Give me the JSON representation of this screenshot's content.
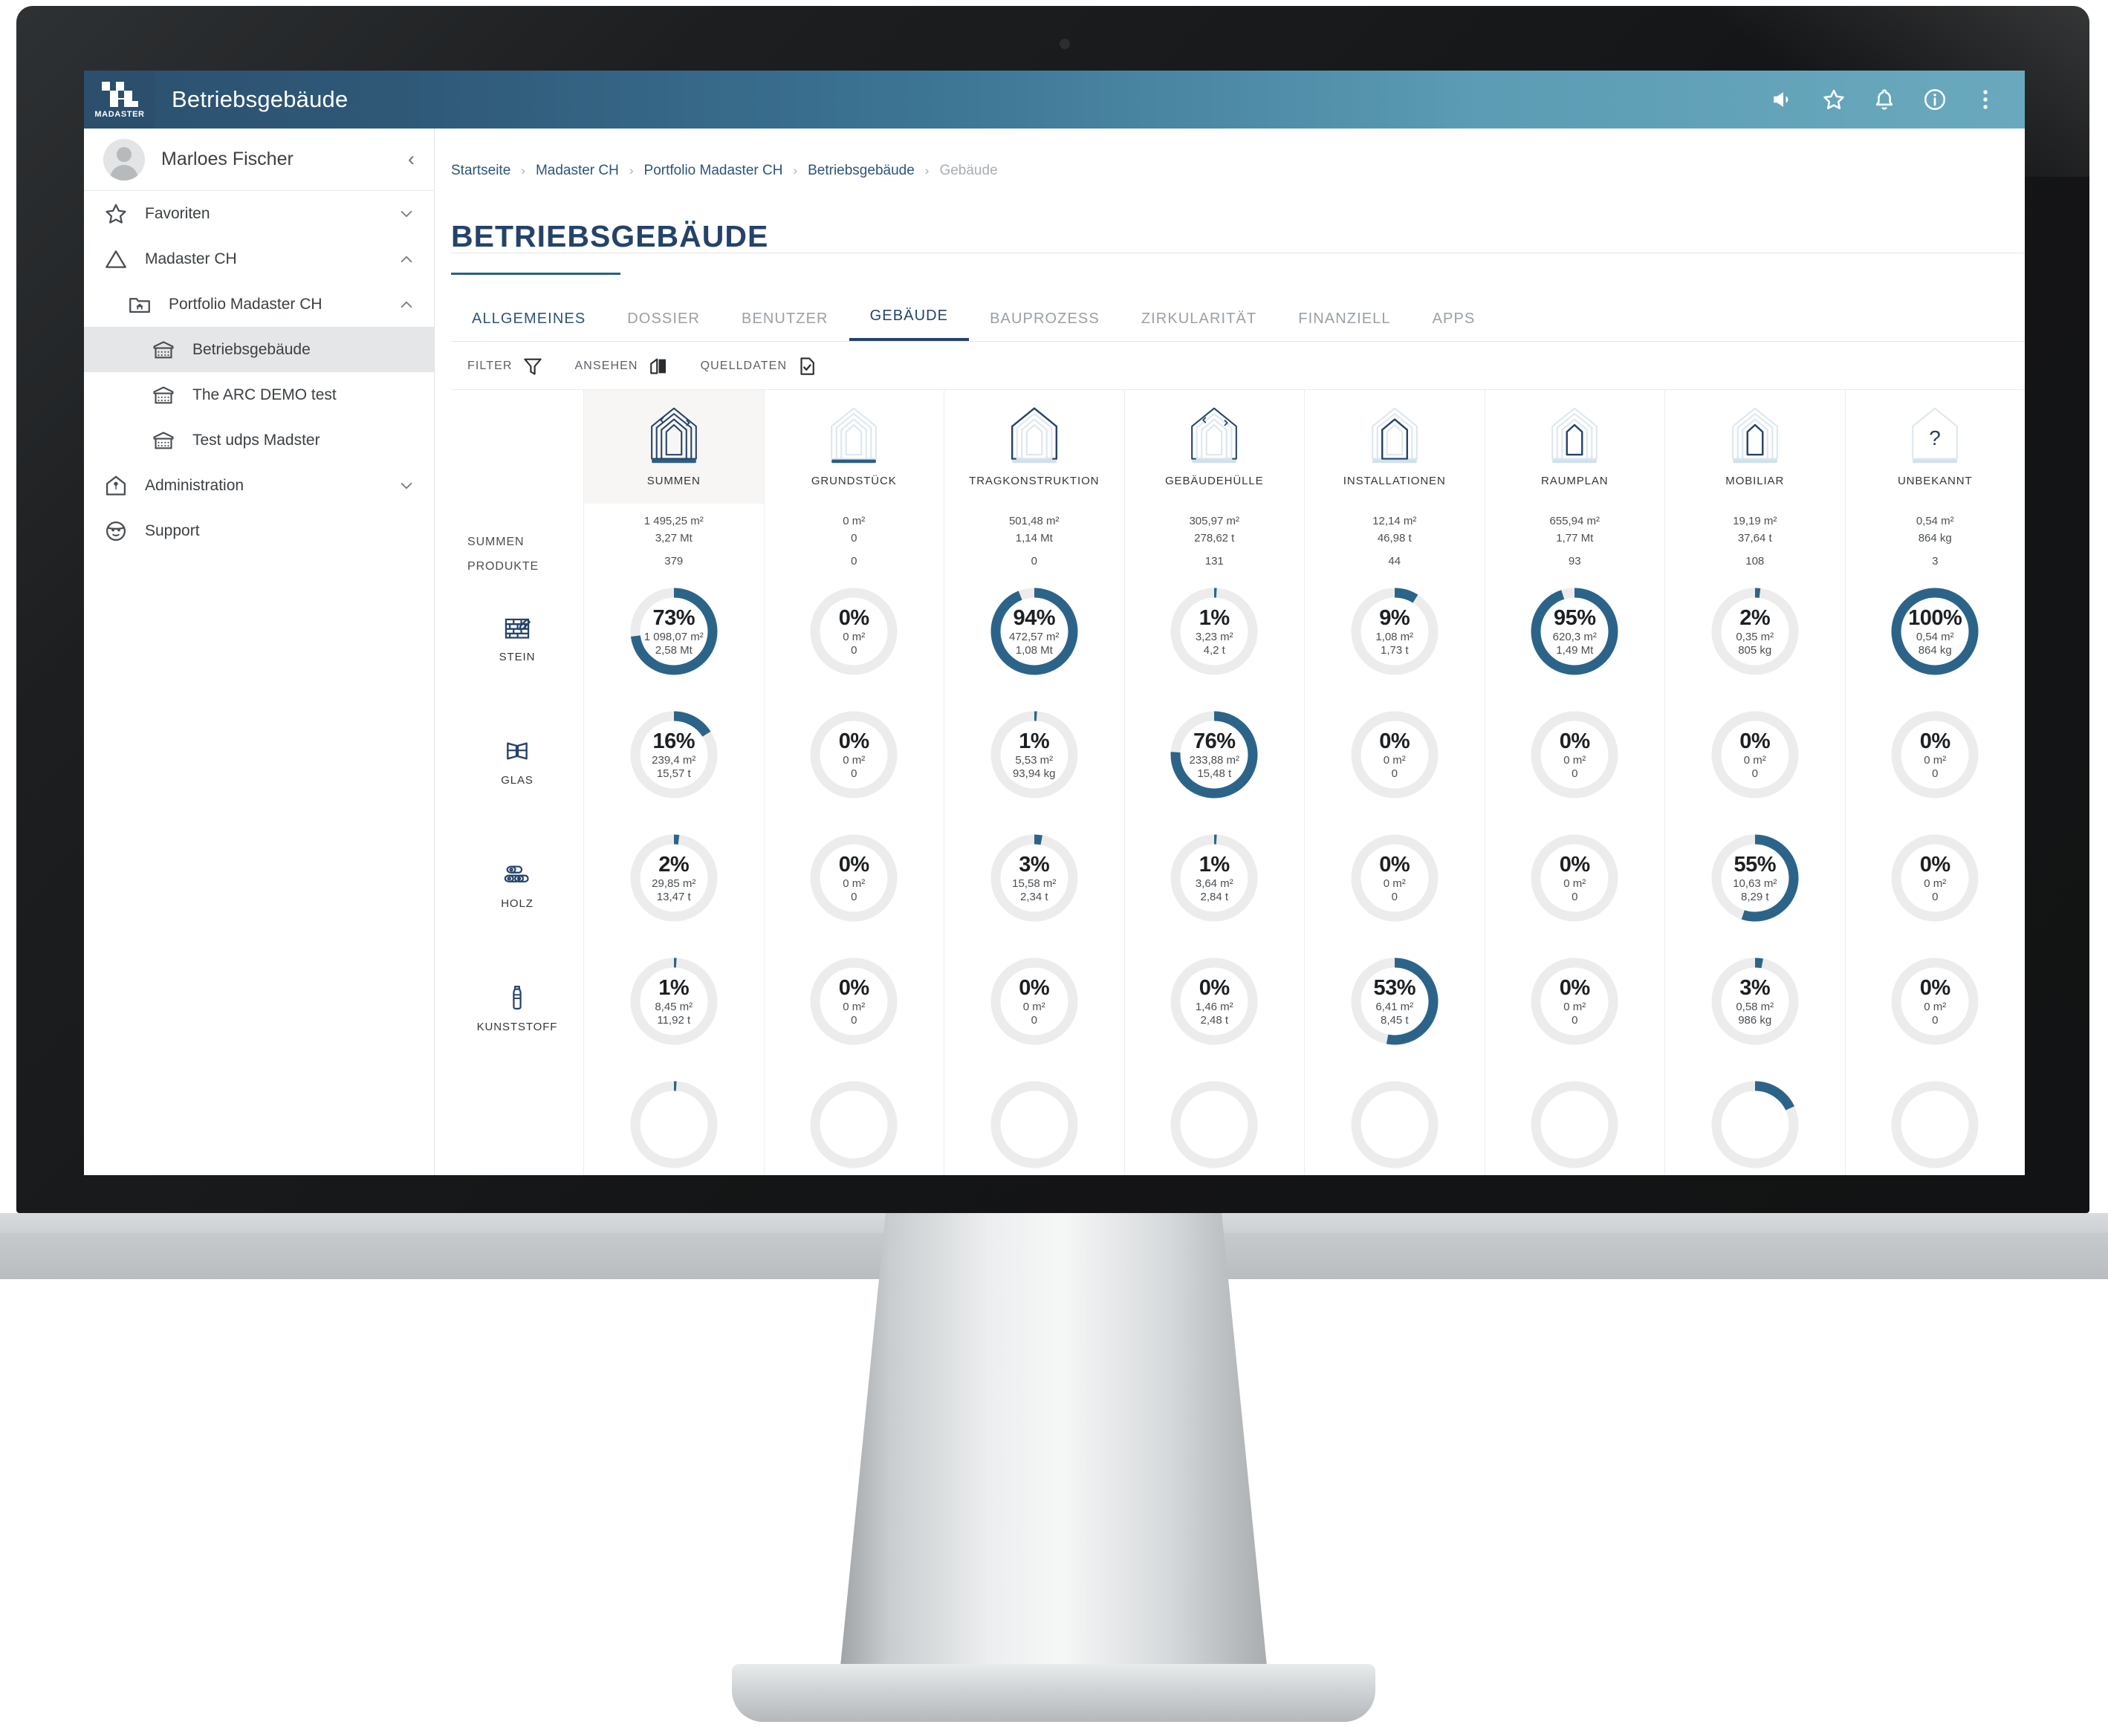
{
  "topbar": {
    "logo_word": "MADASTER",
    "app_title": "Betriebsgebäude",
    "actions": [
      {
        "name": "announcement-icon",
        "label": "Ankündigungen"
      },
      {
        "name": "favorite-star-icon",
        "label": "Favoriten"
      },
      {
        "name": "bell-icon",
        "label": "Benachrichtigungen"
      },
      {
        "name": "info-icon",
        "label": "Information"
      },
      {
        "name": "more-vertical-icon",
        "label": "Mehr"
      }
    ]
  },
  "sidebar": {
    "user_name": "Marloes Fischer",
    "collapse_glyph": "‹",
    "items": [
      {
        "label": "Favoriten",
        "icon": "star-icon",
        "level": 0,
        "chevron": "down",
        "active": false
      },
      {
        "label": "Madaster CH",
        "icon": "triangle-icon",
        "level": 0,
        "chevron": "up",
        "active": false
      },
      {
        "label": "Portfolio Madaster CH",
        "icon": "folder-home-icon",
        "level": 1,
        "chevron": "up",
        "active": false
      },
      {
        "label": "Betriebsgebäude",
        "icon": "building-icon",
        "level": 2,
        "chevron": "none",
        "active": true
      },
      {
        "label": "The ARC DEMO test",
        "icon": "building-icon",
        "level": 2,
        "chevron": "none",
        "active": false
      },
      {
        "label": "Test udps Madster",
        "icon": "building-icon",
        "level": 2,
        "chevron": "none",
        "active": false
      },
      {
        "label": "Administration",
        "icon": "home-shield-icon",
        "level": 0,
        "chevron": "down",
        "active": false
      },
      {
        "label": "Support",
        "icon": "support-face-icon",
        "level": 0,
        "chevron": "none",
        "active": false
      }
    ]
  },
  "main": {
    "breadcrumb": [
      {
        "label": "Startseite",
        "current": false
      },
      {
        "label": "Madaster CH",
        "current": false
      },
      {
        "label": "Portfolio Madaster CH",
        "current": false
      },
      {
        "label": "Betriebsgebäude",
        "current": false
      },
      {
        "label": "Gebäude",
        "current": true
      }
    ],
    "breadcrumb_separator": "›",
    "page_title": "BETRIEBSGEBÄUDE",
    "tabs": [
      {
        "label": "ALLGEMEINES",
        "selected": false,
        "style": "alt"
      },
      {
        "label": "DOSSIER",
        "selected": false,
        "style": "muted"
      },
      {
        "label": "BENUTZER",
        "selected": false,
        "style": "muted"
      },
      {
        "label": "GEBÄUDE",
        "selected": true,
        "style": "selected"
      },
      {
        "label": "BAUPROZESS",
        "selected": false,
        "style": "muted"
      },
      {
        "label": "ZIRKULARITÄT",
        "selected": false,
        "style": "muted"
      },
      {
        "label": "FINANZIELL",
        "selected": false,
        "style": "muted"
      },
      {
        "label": "APPS",
        "selected": false,
        "style": "muted"
      }
    ],
    "toolbar": [
      {
        "label": "FILTER",
        "icon": "funnel-icon"
      },
      {
        "label": "ANSEHEN",
        "icon": "view-panels-icon"
      },
      {
        "label": "QUELLDATEN",
        "icon": "document-check-icon"
      }
    ]
  },
  "matrix": {
    "row_header_labels": {
      "sum": "SUMMEN",
      "products": "PRODUKTE"
    },
    "columns": [
      {
        "name": "SUMMEN",
        "icon": "house-layers-all-icon",
        "highlight": true,
        "area": "1 495,25 m²",
        "mass": "3,27 Mt",
        "products": "379"
      },
      {
        "name": "GRUNDSTÜCK",
        "icon": "house-ground-icon",
        "highlight": false,
        "area": "0 m²",
        "mass": "0",
        "products": "0"
      },
      {
        "name": "TRAGKONSTRUKTION",
        "icon": "house-structure-icon",
        "highlight": false,
        "area": "501,48 m²",
        "mass": "1,14 Mt",
        "products": "0"
      },
      {
        "name": "GEBÄUDEHÜLLE",
        "icon": "house-skin-icon",
        "highlight": false,
        "area": "305,97 m²",
        "mass": "278,62 t",
        "products": "131"
      },
      {
        "name": "INSTALLATIONEN",
        "icon": "house-installations-icon",
        "highlight": false,
        "area": "12,14 m²",
        "mass": "46,98 t",
        "products": "44"
      },
      {
        "name": "RAUMPLAN",
        "icon": "house-spaceplan-icon",
        "highlight": false,
        "area": "655,94 m²",
        "mass": "1,77 Mt",
        "products": "93"
      },
      {
        "name": "MOBILIAR",
        "icon": "house-furniture-icon",
        "highlight": false,
        "area": "19,19 m²",
        "mass": "37,64 t",
        "products": "108"
      },
      {
        "name": "UNBEKANNT",
        "icon": "house-unknown-icon",
        "highlight": false,
        "area": "0,54 m²",
        "mass": "864 kg",
        "products": "3"
      }
    ],
    "rows": [
      {
        "name": "STEIN",
        "icon": "brick-wall-icon",
        "cells": [
          {
            "pct": 73,
            "pct_label": "73%",
            "area": "1 098,07 m²",
            "mass": "2,58 Mt"
          },
          {
            "pct": 0,
            "pct_label": "0%",
            "area": "0 m²",
            "mass": "0"
          },
          {
            "pct": 94,
            "pct_label": "94%",
            "area": "472,57 m²",
            "mass": "1,08 Mt"
          },
          {
            "pct": 1,
            "pct_label": "1%",
            "area": "3,23 m²",
            "mass": "4,2 t"
          },
          {
            "pct": 9,
            "pct_label": "9%",
            "area": "1,08 m²",
            "mass": "1,73 t"
          },
          {
            "pct": 95,
            "pct_label": "95%",
            "area": "620,3 m²",
            "mass": "1,49 Mt"
          },
          {
            "pct": 2,
            "pct_label": "2%",
            "area": "0,35 m²",
            "mass": "805 kg"
          },
          {
            "pct": 100,
            "pct_label": "100%",
            "area": "0,54 m²",
            "mass": "864 kg"
          }
        ]
      },
      {
        "name": "GLAS",
        "icon": "window-glass-icon",
        "cells": [
          {
            "pct": 16,
            "pct_label": "16%",
            "area": "239,4 m²",
            "mass": "15,57 t"
          },
          {
            "pct": 0,
            "pct_label": "0%",
            "area": "0 m²",
            "mass": "0"
          },
          {
            "pct": 1,
            "pct_label": "1%",
            "area": "5,53 m²",
            "mass": "93,94 kg"
          },
          {
            "pct": 76,
            "pct_label": "76%",
            "area": "233,88 m²",
            "mass": "15,48 t"
          },
          {
            "pct": 0,
            "pct_label": "0%",
            "area": "0 m²",
            "mass": "0"
          },
          {
            "pct": 0,
            "pct_label": "0%",
            "area": "0 m²",
            "mass": "0"
          },
          {
            "pct": 0,
            "pct_label": "0%",
            "area": "0 m²",
            "mass": "0"
          },
          {
            "pct": 0,
            "pct_label": "0%",
            "area": "0 m²",
            "mass": "0"
          }
        ]
      },
      {
        "name": "HOLZ",
        "icon": "timber-logs-icon",
        "cells": [
          {
            "pct": 2,
            "pct_label": "2%",
            "area": "29,85 m²",
            "mass": "13,47 t"
          },
          {
            "pct": 0,
            "pct_label": "0%",
            "area": "0 m²",
            "mass": "0"
          },
          {
            "pct": 3,
            "pct_label": "3%",
            "area": "15,58 m²",
            "mass": "2,34 t"
          },
          {
            "pct": 1,
            "pct_label": "1%",
            "area": "3,64 m²",
            "mass": "2,84 t"
          },
          {
            "pct": 0,
            "pct_label": "0%",
            "area": "0 m²",
            "mass": "0"
          },
          {
            "pct": 0,
            "pct_label": "0%",
            "area": "0 m²",
            "mass": "0"
          },
          {
            "pct": 55,
            "pct_label": "55%",
            "area": "10,63 m²",
            "mass": "8,29 t"
          },
          {
            "pct": 0,
            "pct_label": "0%",
            "area": "0 m²",
            "mass": "0"
          }
        ]
      },
      {
        "name": "KUNSTSTOFF",
        "icon": "plastic-bottle-icon",
        "cells": [
          {
            "pct": 1,
            "pct_label": "1%",
            "area": "8,45 m²",
            "mass": "11,92 t"
          },
          {
            "pct": 0,
            "pct_label": "0%",
            "area": "0 m²",
            "mass": "0"
          },
          {
            "pct": 0,
            "pct_label": "0%",
            "area": "0 m²",
            "mass": "0"
          },
          {
            "pct": 0,
            "pct_label": "0%",
            "area": "1,46 m²",
            "mass": "2,48 t"
          },
          {
            "pct": 53,
            "pct_label": "53%",
            "area": "6,41 m²",
            "mass": "8,45 t"
          },
          {
            "pct": 0,
            "pct_label": "0%",
            "area": "0 m²",
            "mass": "0"
          },
          {
            "pct": 3,
            "pct_label": "3%",
            "area": "0,58 m²",
            "mass": "986 kg"
          },
          {
            "pct": 0,
            "pct_label": "0%",
            "area": "0 m²",
            "mass": "0"
          }
        ]
      },
      {
        "name": "",
        "icon": "partial-row-icon",
        "partial": true,
        "cells": [
          {
            "pct": 1,
            "pct_label": "",
            "area": "",
            "mass": ""
          },
          {
            "pct": 0,
            "pct_label": "",
            "area": "",
            "mass": ""
          },
          {
            "pct": 0,
            "pct_label": "",
            "area": "",
            "mass": ""
          },
          {
            "pct": 0,
            "pct_label": "",
            "area": "",
            "mass": ""
          },
          {
            "pct": 0,
            "pct_label": "",
            "area": "",
            "mass": ""
          },
          {
            "pct": 0,
            "pct_label": "",
            "area": "",
            "mass": ""
          },
          {
            "pct": 18,
            "pct_label": "",
            "area": "",
            "mass": ""
          },
          {
            "pct": 0,
            "pct_label": "",
            "area": "",
            "mass": ""
          }
        ]
      }
    ]
  },
  "colors": {
    "brand_dark": "#24436a",
    "donut_fill": "#2c6489",
    "donut_track": "#ececec",
    "topbar_left": "#2c5170",
    "topbar_right": "#6aa9bd"
  }
}
